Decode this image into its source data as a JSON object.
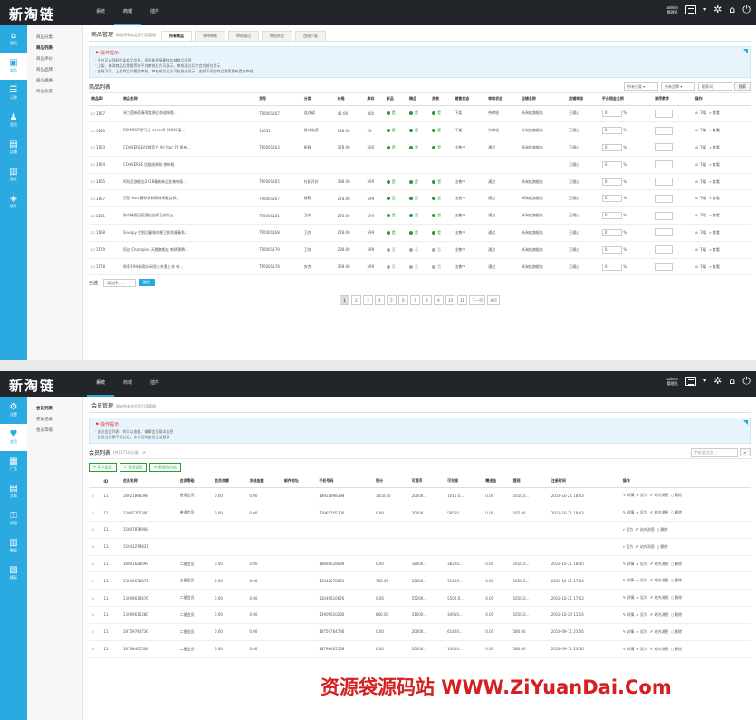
{
  "brand": {
    "logo": "新淘链",
    "logo_sub": "",
    "admin_line1": "admin",
    "admin_line2": "管理员"
  },
  "screen1": {
    "top_nav": [
      "系统",
      "商城",
      "插件"
    ],
    "active_nav": 1,
    "left_nav": [
      "首页",
      "商品",
      "订单",
      "会员",
      "店铺",
      "统计",
      "插件"
    ],
    "left_active": 1,
    "sub_nav": [
      "商品分类",
      "商品列表",
      "商品评价",
      "商品品牌",
      "商品规格",
      "商品标签"
    ],
    "sub_active": 1,
    "title": "商品管理",
    "desc": "网站所有商品索引及管理",
    "tabs": [
      "所有商品",
      "等待审核",
      "审核通过",
      "审核失败",
      "违规下架"
    ],
    "tip_title": "操作提示",
    "tips": [
      "· 平台可以强制下架商品信息，但不能直接删除店铺商品信息",
      "· 上架、修改商品后需要等待平台审核后方可展示，审核通过后才会在前台显示",
      "· 违规下架、上架商品均需要审核，审核成功后方可在前台显示，违规下架的商品需要重新提交审核"
    ],
    "list_title": "商品列表",
    "filter": {
      "sel1": "所有分类",
      "sel2": "所有品牌",
      "search": "搜索词",
      "btn": "搜索"
    },
    "columns": [
      "商品ID",
      "商品名称",
      "货号",
      "分类",
      "价格",
      "库存",
      "新品",
      "精品",
      "热卖",
      "销售状态",
      "审核状态",
      "店铺名称",
      "店铺审核",
      "平台佣金比例",
      "排序数字",
      "操作"
    ],
    "rows": [
      {
        "id": "1167",
        "name": "米兰茵新款春季女装连衣裙韩版...",
        "sn": "TP0001167",
        "cat": "连衣裙",
        "price": "42.00",
        "stock": "300",
        "n": "on",
        "b": "on",
        "h": "on",
        "sale": "下架",
        "audit": "待审核",
        "shop": "新淘链旗舰店",
        "shop_audit": "已通过",
        "rate": "0",
        "op1": "下架",
        "op2": "查看"
      },
      {
        "id": "1160",
        "name": "ROMOSS/罗马仕 sense6 20000毫...",
        "sn": "10031",
        "cat": "移动电源",
        "price": "128.00",
        "stock": "20",
        "n": "on",
        "b": "on",
        "h": "on",
        "sale": "下架",
        "audit": "待审核",
        "shop": "新淘链旗舰店",
        "shop_audit": "已通过",
        "rate": "0",
        "op1": "下架",
        "op2": "查看"
      },
      {
        "id": "1163",
        "name": "CONVERSE/匡威官方 All Star 72 帆布...",
        "sn": "TP0001163",
        "cat": "帆鞋",
        "price": "378.00",
        "stock": "500",
        "n": "on",
        "b": "on",
        "h": "on",
        "sale": "出售中",
        "audit": "通过",
        "shop": "新淘链旗舰店",
        "shop_audit": "已通过",
        "rate": "0",
        "op1": "下架",
        "op2": "查看"
      },
      {
        "id": "1164",
        "name": "CONVERSE 匡威经典款 帆布鞋",
        "sn": "",
        "cat": "",
        "price": "",
        "stock": "",
        "n": "",
        "b": "",
        "h": "",
        "sale": "",
        "audit": "",
        "shop": "",
        "shop_audit": "已通过",
        "rate": "0",
        "op1": "下架",
        "op2": "查看"
      },
      {
        "id": "1165",
        "name": "阿瑞瓦旗舰店2018春装新品女装韩版...",
        "sn": "TP0001165",
        "cat": "针织开衫",
        "price": "398.00",
        "stock": "599",
        "n": "on",
        "b": "on",
        "h": "on",
        "sale": "出售中",
        "audit": "通过",
        "shop": "新淘链旗舰店",
        "shop_audit": "已通过",
        "rate": "0",
        "op1": "下架",
        "op2": "查看"
      },
      {
        "id": "1167",
        "name": "百丽 Vans春秋季新款休闲鞋女款...",
        "sn": "TP0001167",
        "cat": "板鞋",
        "price": "278.00",
        "stock": "599",
        "n": "on",
        "b": "on",
        "h": "on",
        "sale": "出售中",
        "audit": "通过",
        "shop": "新淘链旗舰店",
        "shop_audit": "已通过",
        "rate": "0",
        "op1": "下架",
        "op2": "查看"
      },
      {
        "id": "1181",
        "name": "秋冬韩版百搭宽松加厚卫衣女士...",
        "sn": "TP0001181",
        "cat": "卫衣",
        "price": "278.00",
        "stock": "599",
        "n": "on",
        "b": "on",
        "h": "on",
        "sale": "出售中",
        "audit": "通过",
        "shop": "新淘链旗舰店",
        "shop_audit": "已通过",
        "rate": "0",
        "op1": "下架",
        "op2": "查看"
      },
      {
        "id": "1168",
        "name": "Snoopy 史努比童装纯棉卫衣男童春秋...",
        "sn": "TP0001168",
        "cat": "卫衣",
        "price": "278.00",
        "stock": "599",
        "n": "on",
        "b": "on",
        "h": "on",
        "sale": "出售中",
        "audit": "通过",
        "shop": "新淘链旗舰店",
        "shop_audit": "已通过",
        "rate": "0",
        "op1": "下架",
        "op2": "查看"
      },
      {
        "id": "1179",
        "name": "阿迪 Champion 天猫旗舰店 刺绣潮牌...",
        "sn": "TP0001179",
        "cat": "卫衣",
        "price": "288.00",
        "stock": "599",
        "n": "off",
        "b": "off",
        "h": "off",
        "sale": "出售中",
        "audit": "通过",
        "shop": "新淘链旗舰店",
        "shop_audit": "已通过",
        "rate": "0",
        "op1": "下架",
        "op2": "查看"
      },
      {
        "id": "1178",
        "name": "秋季19年新款休闲男士外套上衣 韩...",
        "sn": "TP0001178",
        "cat": "夹克",
        "price": "328.00",
        "stock": "599",
        "n": "off",
        "b": "off",
        "h": "off",
        "sale": "出售中",
        "audit": "通过",
        "shop": "新淘链旗舰店",
        "shop_audit": "已通过",
        "rate": "0",
        "op1": "下架",
        "op2": "查看"
      }
    ],
    "bulk": {
      "label": "全选",
      "select": "请选择...",
      "btn": "确定"
    },
    "pages": [
      "1",
      "2",
      "3",
      "4",
      "5",
      "6",
      "7",
      "8",
      "9",
      "10",
      "11",
      "下一页",
      "末页"
    ],
    "page_active": 0
  },
  "screen2": {
    "top_nav": [
      "系统",
      "商城",
      "插件"
    ],
    "active_nav": 0,
    "left_nav": [
      "设置",
      "会员",
      "广告",
      "文章",
      "权限",
      "数据",
      "模板"
    ],
    "left_active": 1,
    "sub_nav": [
      "会员列表",
      "充值记录",
      "会员等级"
    ],
    "sub_active": 0,
    "title": "会员管理",
    "desc": "网站所有会员索引及管理",
    "tip_title": "操作提示",
    "tips": [
      "· 通过会员列表，你可以查看、编辑会员基本信息",
      "· 会员注册需手机认证，未认证的会员无法登录"
    ],
    "list_title": "会员列表",
    "list_count": "(共1171条记录)",
    "search": "手机/会员名...",
    "btns": [
      "导入会员",
      "导出会员",
      "发送站内信"
    ],
    "columns": [
      "",
      "ID",
      "会员名称",
      "会员等级",
      "会员余额",
      "冻结金额",
      "邮件地址",
      "手机号码",
      "积分",
      "可提币",
      "可兑现",
      "赠送金",
      "提现",
      "注册时间",
      "操作"
    ],
    "rows": [
      {
        "id": "11..",
        "name": "18921898398",
        "level": "普通会员",
        "bal": "0.00",
        "frz": "0.00",
        "mail": "",
        "phone": "18921898398",
        "pts": "1050.00",
        "c1": "20000...",
        "c2": "1016.0...",
        "c3": "0.00",
        "c4": "1650.0...",
        "time": "2018-10-21 18:43",
        "ops": [
          "详情",
          "设为",
          "站内消息",
          "删除"
        ]
      },
      {
        "id": "11..",
        "name": "13965705300",
        "level": "普通会员",
        "bal": "0.00",
        "frz": "0.00",
        "mail": "",
        "phone": "13965705300",
        "pts": "0.00",
        "c1": "20000...",
        "c2": "58560...",
        "c3": "0.00",
        "c4": "165.00",
        "time": "2018-10-21 18:43",
        "ops": [
          "详情",
          "设为",
          "站内消息",
          "删除"
        ]
      },
      {
        "id": "11..",
        "name": "15807878908",
        "level": "",
        "bal": "",
        "frz": "",
        "mail": "",
        "phone": "",
        "pts": "",
        "c1": "",
        "c2": "",
        "c3": "",
        "c4": "",
        "time": "",
        "ops": [
          "",
          "设为",
          "站内消息",
          "删除"
        ]
      },
      {
        "id": "11..",
        "name": "15943279831",
        "level": "",
        "bal": "",
        "frz": "",
        "mail": "",
        "phone": "",
        "pts": "",
        "c1": "",
        "c2": "",
        "c3": "",
        "c4": "",
        "time": "",
        "ops": [
          "",
          "设为",
          "站内消息",
          "删除"
        ]
      },
      {
        "id": "11..",
        "name": "18891628699",
        "level": "二星会员",
        "bal": "0.00",
        "frz": "0.00",
        "mail": "",
        "phone": "18891628699",
        "pts": "0.00",
        "c1": "18000...",
        "c2": "38220...",
        "c3": "0.00",
        "c4": "1650.0...",
        "time": "2018-10-21 18:40",
        "ops": [
          "详情",
          "设为",
          "站内消息",
          "删除"
        ]
      },
      {
        "id": "11..",
        "name": "13042678871",
        "level": "五星会员",
        "bal": "0.00",
        "frz": "0.00",
        "mail": "",
        "phone": "13042678871",
        "pts": "700.00",
        "c1": "18000...",
        "c2": "31400...",
        "c3": "0.00",
        "c4": "1650.0...",
        "time": "2018-10-21 17:04",
        "ops": [
          "详情",
          "设为",
          "站内消息",
          "删除"
        ]
      },
      {
        "id": "11..",
        "name": "13049610676",
        "level": "二星会员",
        "bal": "0.00",
        "frz": "0.00",
        "mail": "",
        "phone": "13049610676",
        "pts": "0.00",
        "c1": "55200...",
        "c2": "5500.0...",
        "c3": "0.00",
        "c4": "1650.0...",
        "time": "2018-10-21 17:03",
        "ops": [
          "详情",
          "设为",
          "站内消息",
          "删除"
        ]
      },
      {
        "id": "11..",
        "name": "13909610280",
        "level": "二星会员",
        "bal": "0.00",
        "frz": "0.00",
        "mail": "",
        "phone": "13909610280",
        "pts": "840.00",
        "c1": "31000...",
        "c2": "34950...",
        "c3": "0.00",
        "c4": "1650.0...",
        "time": "2018-10-20 11:16",
        "ops": [
          "详情",
          "设为",
          "站内消息",
          "删除"
        ]
      },
      {
        "id": "11..",
        "name": "18759784736",
        "level": "二星会员",
        "bal": "0.00",
        "frz": "0.00",
        "mail": "",
        "phone": "18759784736",
        "pts": "0.00",
        "c1": "20000...",
        "c2": "61400...",
        "c3": "0.00",
        "c4": "580.00",
        "time": "2018-09-11 23:56",
        "ops": [
          "详情",
          "设为",
          "站内消息",
          "删除"
        ]
      },
      {
        "id": "11..",
        "name": "18798465508",
        "level": "二星会员",
        "bal": "0.00",
        "frz": "0.00",
        "mail": "",
        "phone": "18798465508",
        "pts": "0.00",
        "c1": "20000...",
        "c2": "10000...",
        "c3": "0.00",
        "c4": "580.00",
        "time": "2018-09-11 23:56",
        "ops": [
          "详情",
          "设为",
          "站内消息",
          "删除"
        ]
      }
    ]
  },
  "watermark": "资源袋源码站 WWW.ZiYuanDai.Com",
  "colors": {
    "accent": "#2ba9e1",
    "topbar": "#22262a",
    "ok": "#2a9a3a",
    "watermark": "#d42020"
  }
}
